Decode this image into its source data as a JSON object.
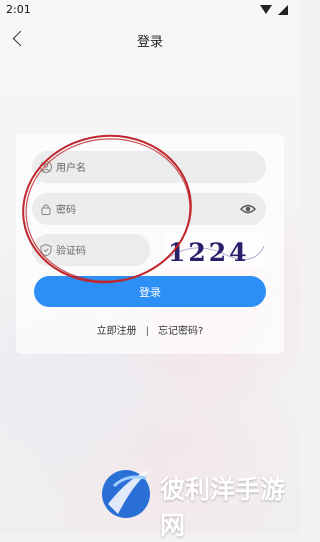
{
  "status_bar": {
    "time": "2:01"
  },
  "header": {
    "title": "登录"
  },
  "form": {
    "username_placeholder": "用户名",
    "password_placeholder": "密码",
    "captcha_placeholder": "验证码",
    "captcha_text": "1224",
    "login_label": "登录"
  },
  "links": {
    "register": "立即注册",
    "separator": "|",
    "forgot": "忘记密码?"
  },
  "watermark": {
    "text": "彼利洋手游网"
  },
  "colors": {
    "primary": "#2d8ff5",
    "annotation_circle": "#c0262b",
    "captcha_ink": "#2a1f6b"
  },
  "icons": {
    "back": "chevron-left-icon",
    "username": "user-icon",
    "password": "lock-icon",
    "captcha": "shield-icon",
    "show_password": "eye-icon",
    "logo": "globe-swoosh-icon"
  }
}
